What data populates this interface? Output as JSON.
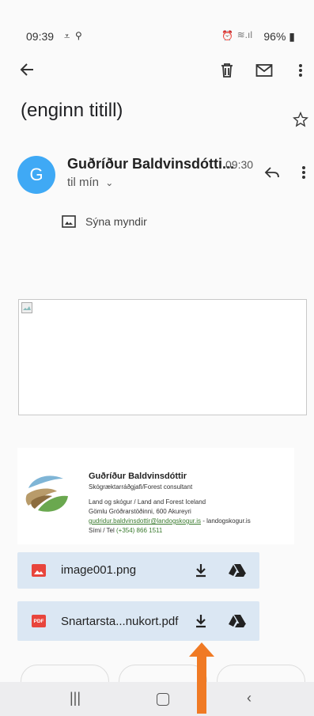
{
  "status": {
    "time": "09:39",
    "battery": "96%"
  },
  "email": {
    "subject": "(enginn titill)",
    "avatar_letter": "G",
    "sender": "Guðríður Baldvinsdótti...",
    "time": "09:30",
    "recipient": "til mín",
    "show_images": "Sýna myndir"
  },
  "signature": {
    "name": "Guðríður Baldvinsdóttir",
    "role": "Skógræktarráðgjafi/Forest consultant",
    "org": "Land og skógur / Land and Forest Iceland",
    "address": "Gömlu Gróðrarstöðinni, 600 Akureyri",
    "email_link": "gudridur.baldvinsdottir@landogskogur.is",
    "email_suffix": " - landogskogur.is",
    "phone_label": "Sími / Tel ",
    "phone": "(+354) 866 1511"
  },
  "attachments": [
    {
      "name": "image001.png",
      "type_label": ""
    },
    {
      "name": "Snartarsta...nukort.pdf",
      "type_label": "PDF"
    }
  ],
  "colors": {
    "avatar": "#3fa9f5",
    "attachment_bg": "#dbe7f3",
    "arrow": "#f07a24"
  }
}
